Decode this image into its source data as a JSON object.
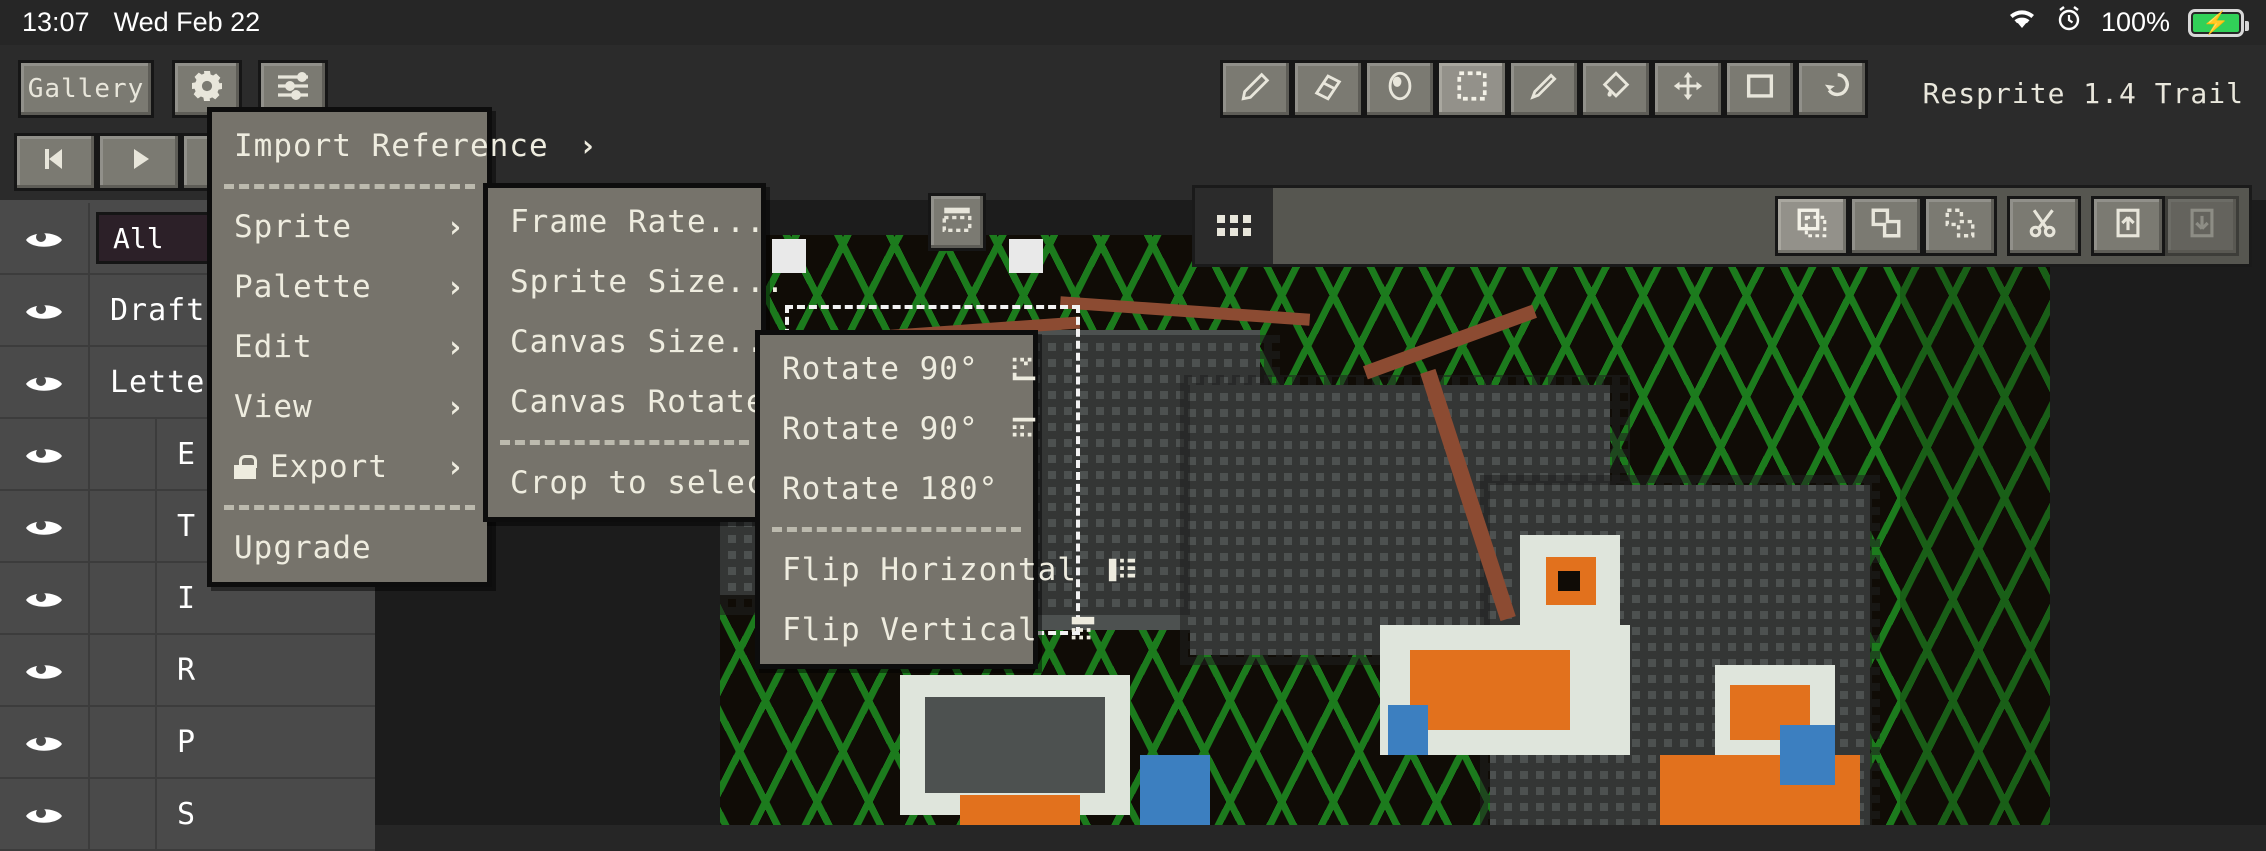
{
  "statusbar": {
    "time": "13:07",
    "date": "Wed Feb 22",
    "battery_percent": "100%",
    "icons": [
      "wifi-icon",
      "alarm-clock-icon",
      "battery-charging-icon"
    ]
  },
  "topbar": {
    "gallery_label": "Gallery",
    "settings_icon": "gear-icon",
    "menu_icon": "sliders-icon",
    "app_title": "Resprite 1.4 Trail",
    "animation": [
      {
        "name": "prev-frame-button",
        "icon": "step-back-icon"
      },
      {
        "name": "play-button",
        "icon": "play-icon"
      },
      {
        "name": "next-frame-button",
        "icon": "step-forward-icon"
      }
    ],
    "tools": [
      {
        "name": "pencil-tool",
        "icon": "pencil-icon",
        "active": false
      },
      {
        "name": "eraser-tool",
        "icon": "eraser-icon",
        "active": false
      },
      {
        "name": "smudge-tool",
        "icon": "blob-icon",
        "active": false
      },
      {
        "name": "select-tool",
        "icon": "marquee-icon",
        "active": true
      },
      {
        "name": "pen-tool",
        "icon": "pen-icon",
        "active": false
      },
      {
        "name": "fill-tool",
        "icon": "bucket-icon",
        "active": false
      },
      {
        "name": "move-tool",
        "icon": "move-icon",
        "active": false
      },
      {
        "name": "shape-tool",
        "icon": "rectangle-icon",
        "active": false
      },
      {
        "name": "undo-tool",
        "icon": "undo-arrow-icon",
        "active": false
      }
    ]
  },
  "selection_toolbar": {
    "grip_icon": "drag-dots-icon",
    "buttons": [
      {
        "name": "selection-replace-button",
        "icon": "selection-replace-icon",
        "active": true,
        "disabled": false
      },
      {
        "name": "selection-add-button",
        "icon": "selection-add-icon",
        "active": false,
        "disabled": false
      },
      {
        "name": "selection-subtract-button",
        "icon": "selection-subtract-icon",
        "active": false,
        "disabled": false
      },
      {
        "name": "cut-button",
        "icon": "scissors-icon",
        "active": false,
        "disabled": false
      },
      {
        "name": "lift-button",
        "icon": "lift-up-icon",
        "active": false,
        "disabled": false
      },
      {
        "name": "stamp-button",
        "icon": "stamp-down-icon",
        "active": false,
        "disabled": true
      }
    ],
    "crop_mini_icon": "crop-to-selection-icon"
  },
  "layers": {
    "filter_value": "All",
    "eye_icon": "eye-icon",
    "rows": [
      {
        "label": "All",
        "type": "select",
        "indent": 0
      },
      {
        "label": "Draft",
        "type": "layer",
        "indent": 0
      },
      {
        "label": "Letters",
        "type": "group",
        "indent": 0
      },
      {
        "label": "E",
        "type": "layer",
        "indent": 1
      },
      {
        "label": "T",
        "type": "layer",
        "indent": 1
      },
      {
        "label": "I",
        "type": "layer",
        "indent": 1
      },
      {
        "label": "R",
        "type": "layer",
        "indent": 1
      },
      {
        "label": "P",
        "type": "layer",
        "indent": 1
      },
      {
        "label": "S",
        "type": "layer",
        "indent": 1
      }
    ]
  },
  "menus": {
    "main": [
      {
        "label": "Import Reference",
        "submenu": true,
        "lock": false
      },
      {
        "sep": true
      },
      {
        "label": "Sprite",
        "submenu": true,
        "lock": false
      },
      {
        "label": "Palette",
        "submenu": true,
        "lock": false
      },
      {
        "label": "Edit",
        "submenu": true,
        "lock": false
      },
      {
        "label": "View",
        "submenu": true,
        "lock": false
      },
      {
        "label": "Export",
        "submenu": true,
        "lock": true
      },
      {
        "sep": true
      },
      {
        "label": "Upgrade",
        "submenu": false,
        "lock": false
      }
    ],
    "sprite": [
      {
        "label": "Frame Rate...",
        "submenu": false
      },
      {
        "label": "Sprite Size...",
        "submenu": false
      },
      {
        "label": "Canvas Size...",
        "submenu": false
      },
      {
        "label": "Canvas Rotate",
        "submenu": true
      },
      {
        "sep": true
      },
      {
        "label": "Crop to selection",
        "submenu": false
      }
    ],
    "canvas_rotate": [
      {
        "label": "Rotate 90°",
        "icon": "rotate-ccw-icon"
      },
      {
        "label": "Rotate 90°",
        "icon": "rotate-cw-icon"
      },
      {
        "label": "Rotate 180°",
        "icon": ""
      },
      {
        "sep": true
      },
      {
        "label": "Flip Horizontal",
        "icon": "flip-horizontal-icon"
      },
      {
        "label": "Flip Vertical",
        "icon": "flip-vertical-icon"
      }
    ]
  },
  "colors": {
    "menu_bg": "#76736b",
    "panel_bg": "#2f2f2f",
    "button_bg": "#7b7a72",
    "text": "#eeecdf",
    "accent_orange": "#e2711d",
    "accent_green": "#1f8f22",
    "battery_green": "#31d158"
  }
}
